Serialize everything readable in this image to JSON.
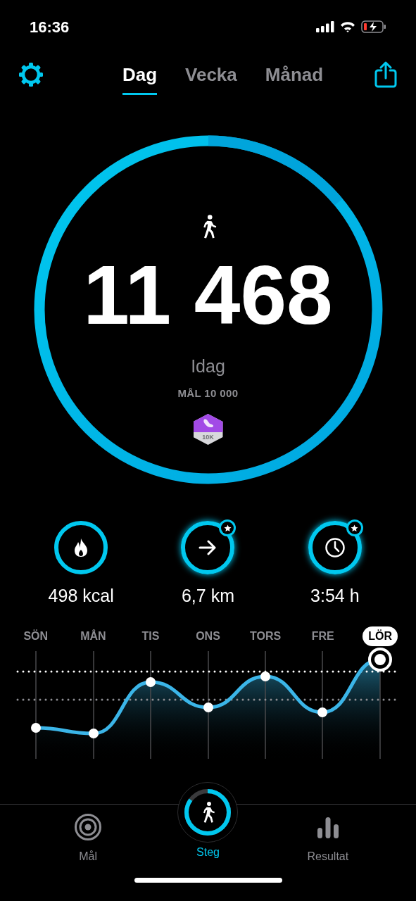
{
  "status_bar": {
    "time": "16:36"
  },
  "tabs": [
    {
      "label": "Dag",
      "selected": true
    },
    {
      "label": "Vecka",
      "selected": false
    },
    {
      "label": "Månad",
      "selected": false
    }
  ],
  "steps": {
    "count": "11 468",
    "period": "Idag",
    "goal": "MÅL 10 000",
    "badge": "10K"
  },
  "stats": [
    {
      "kind": "calories",
      "value": "498 kcal",
      "achieved": false
    },
    {
      "kind": "distance",
      "value": "6,7 km",
      "achieved": true
    },
    {
      "kind": "time",
      "value": "3:54 h",
      "achieved": true
    }
  ],
  "chart": {
    "days": [
      {
        "label": "SÖN",
        "selected": false
      },
      {
        "label": "MÅN",
        "selected": false
      },
      {
        "label": "TIS",
        "selected": false
      },
      {
        "label": "ONS",
        "selected": false
      },
      {
        "label": "TORS",
        "selected": false
      },
      {
        "label": "FRE",
        "selected": false
      },
      {
        "label": "LÖR",
        "selected": true
      }
    ]
  },
  "nav": [
    {
      "kind": "goals",
      "label": "Mål",
      "selected": false
    },
    {
      "kind": "steps",
      "label": "Steg",
      "selected": true
    },
    {
      "kind": "results",
      "label": "Resultat",
      "selected": false
    }
  ]
}
